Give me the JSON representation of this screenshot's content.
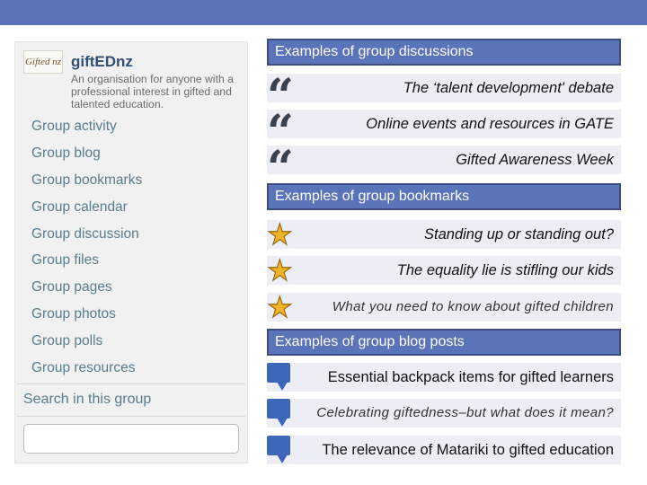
{
  "sidebar": {
    "logo_text": "Gifted nz",
    "brand": "giftEDnz",
    "tagline": "An organisation for anyone with a professional interest in gifted and talented education.",
    "links": [
      "Group activity",
      "Group blog",
      "Group bookmarks",
      "Group calendar",
      "Group discussion",
      "Group files",
      "Group pages",
      "Group photos",
      "Group polls",
      "Group resources"
    ],
    "search_label": "Search in this group",
    "search_placeholder": ""
  },
  "discussions": {
    "header": "Examples of group discussions",
    "icon": "quote-icon",
    "items": [
      "The ‘talent development' debate",
      "Online events and resources in GATE",
      "Gifted Awareness Week"
    ]
  },
  "bookmarks": {
    "header": "Examples of group bookmarks",
    "icon": "star-icon",
    "items": [
      "Standing up or standing out?",
      "The equality lie is stifling our kids",
      "What you need to know about gifted children"
    ]
  },
  "blog_posts": {
    "header": "Examples of group blog posts",
    "icon": "speech-bubble-icon",
    "items": [
      "Essential backpack items for gifted learners",
      "Celebrating giftedness–but what does it mean?",
      "The relevance of Matariki to gifted education"
    ]
  },
  "colors": {
    "accent": "#5b73b8",
    "link": "#587d8e",
    "row_background": "#edeef5",
    "star": "#f0b32a",
    "bubble": "#3f67b9"
  }
}
